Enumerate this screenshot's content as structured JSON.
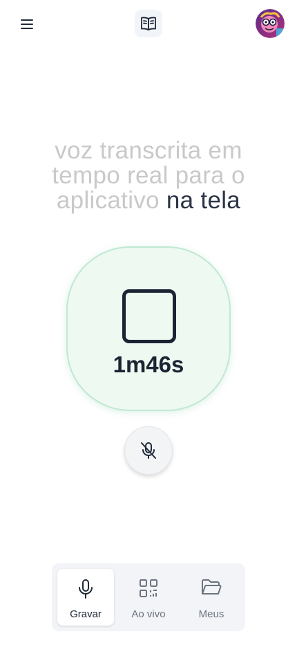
{
  "header": {
    "menu_icon": "hamburger-menu-icon",
    "book_icon": "open-book-icon",
    "avatar_alt": "avatar"
  },
  "transcript": {
    "faded_text": "voz transcrita em tempo real para o aplicativo",
    "current_text": "na tela"
  },
  "recorder": {
    "timer": "1m46s",
    "stop_icon": "stop-square-icon",
    "mute_icon": "mic-off-icon"
  },
  "tabs": [
    {
      "label": "Gravar",
      "icon": "microphone-icon",
      "active": true
    },
    {
      "label": "Ao vivo",
      "icon": "qr-code-icon",
      "active": false
    },
    {
      "label": "Meus",
      "icon": "folder-open-icon",
      "active": false
    }
  ],
  "colors": {
    "record_bg": "#eef9f2",
    "record_border": "#bfe9d2",
    "text_dark": "#1b2433",
    "text_faded": "#c9c9c9"
  }
}
